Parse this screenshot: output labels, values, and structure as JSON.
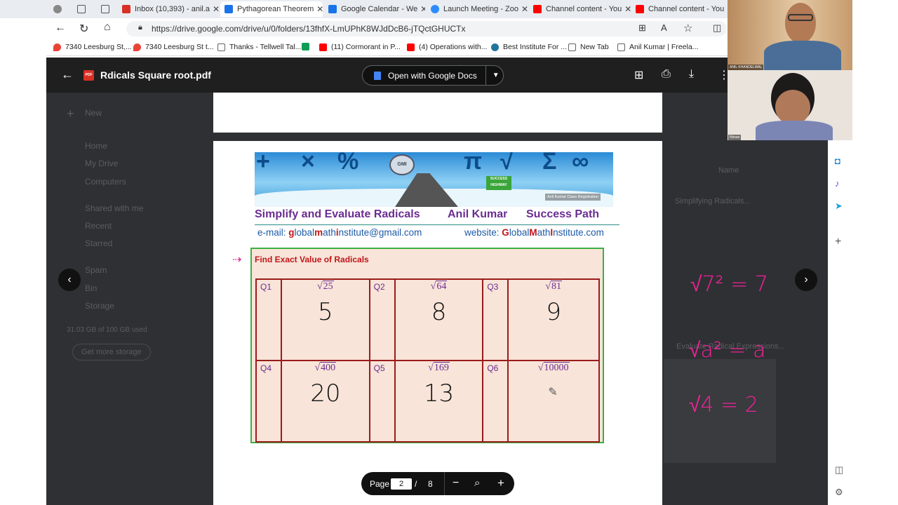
{
  "browser": {
    "tabs": [
      {
        "title": "",
        "color": "#5f6368"
      },
      {
        "title": "",
        "color": "#5f6368"
      },
      {
        "title": "",
        "color": "#5f6368"
      },
      {
        "title": "Inbox (10,393) - anil.a",
        "color": "#d93025"
      },
      {
        "title": "Pythagorean Theorem",
        "color": "#1a73e8"
      },
      {
        "title": "Google Calendar - We",
        "color": "#1a73e8"
      },
      {
        "title": "Launch Meeting - Zoo",
        "color": "#2d8cff"
      },
      {
        "title": "Channel content - You",
        "color": "#ff0000"
      },
      {
        "title": "Channel content - You",
        "color": "#ff0000"
      }
    ],
    "url": "https://drive.google.com/drive/u/0/folders/13fhfX-LmUPhK8WJdDcB6-jTQctGHUCTx",
    "bookmarks": [
      {
        "label": "7340 Leesburg St,...",
        "color": "#ea4335"
      },
      {
        "label": "7340 Leesburg St t...",
        "color": "#ea4335"
      },
      {
        "label": "Thanks - Tellwell Tal...",
        "color": "#5f6368"
      },
      {
        "label": "",
        "color": "#0f9d58"
      },
      {
        "label": "(11) Cormorant in P...",
        "color": "#ff0000"
      },
      {
        "label": "(4) Operations with...",
        "color": "#ff0000"
      },
      {
        "label": "Best Institute For ...",
        "color": "#21759b"
      },
      {
        "label": "New Tab",
        "color": "#5f6368"
      },
      {
        "label": "Anil Kumar | Freela...",
        "color": "#5f6368"
      }
    ]
  },
  "viewer": {
    "file_name": "Rdicals Square root.pdf",
    "pdf_badge": "PDF",
    "open_with": "Open with Google Docs",
    "page_label": "Page",
    "page_current": "2",
    "page_sep": "/",
    "page_total": "8"
  },
  "drive_dimmed": {
    "new": "New",
    "nav": [
      "Home",
      "My Drive",
      "Computers",
      "Shared with me",
      "Recent",
      "Starred",
      "Spam",
      "Bin",
      "Storage"
    ],
    "storage_text": "31.03 GB of 100 GB used",
    "storage_btn": "Get more storage",
    "file1": "Simplifying Radicals...",
    "file2": "Evaluate Radical Expressions...",
    "sort": "Name"
  },
  "document": {
    "banner_symbols": [
      "+",
      "×",
      "%",
      "π",
      "√",
      "Σ",
      "∞"
    ],
    "banner_logo": "GMI",
    "banner_sign": "SUCCESS HIGHWAY",
    "banner_reg": "Anil Kumar Class Registration",
    "subtitle_left": "Simplify and Evaluate Radicals",
    "subtitle_mid": "Anil Kumar",
    "subtitle_right": "Success Path",
    "email_label": "e-mail:",
    "email_parts": [
      "g",
      "lobal",
      "m",
      "ath",
      "i",
      "nstitute@gmail.com"
    ],
    "website_label": "website:",
    "website_parts": [
      "G",
      "lobal",
      "M",
      "ath",
      "I",
      "nstitute.com"
    ],
    "task_title": "Find Exact Value of Radicals",
    "questions": [
      {
        "label": "Q1",
        "radicand": "25",
        "answer": "5"
      },
      {
        "label": "Q2",
        "radicand": "64",
        "answer": "8"
      },
      {
        "label": "Q3",
        "radicand": "81",
        "answer": "9"
      },
      {
        "label": "Q4",
        "radicand": "400",
        "answer": "20"
      },
      {
        "label": "Q5",
        "radicand": "169",
        "answer": "13"
      },
      {
        "label": "Q6",
        "radicand": "10000",
        "answer": ""
      }
    ]
  },
  "handwriting": {
    "line1": "√7² = 7",
    "line2": "√a² = a",
    "line3": "√4 = 2"
  },
  "video": {
    "host_label": "ANIL KHANDELWAL",
    "guest_label": "Nirvan"
  },
  "colors": {
    "accent_purple": "#6b2c91",
    "accent_red": "#c0161a",
    "box_green": "#3cb043",
    "table_border": "#9b1b1b",
    "ink_pink": "#f0229b"
  }
}
